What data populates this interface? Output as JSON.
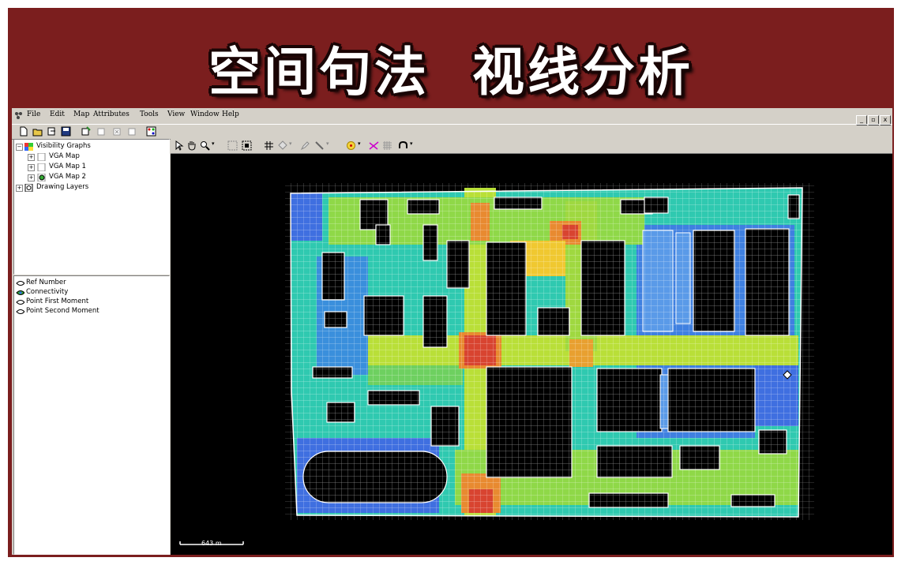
{
  "banner": {
    "title": "空间句法  视线分析"
  },
  "menu": [
    "File",
    "Edit",
    "Map",
    "Attributes",
    "Tools",
    "View",
    "Window",
    "Help"
  ],
  "window_buttons": [
    "_",
    "▫",
    "x"
  ],
  "tree": {
    "root": "Visibility Graphs",
    "maps": [
      "VGA Map",
      "VGA Map 1",
      "VGA Map 2"
    ],
    "drawing": "Drawing Layers"
  },
  "attributes": [
    "Ref Number",
    "Connectivity",
    "Point First Moment",
    "Point Second Moment"
  ],
  "scale_bar": {
    "label": "643 m"
  },
  "colors": {
    "frame": "#7b1e1e",
    "map_background": "#000000",
    "panel": "#d4d0c8"
  }
}
